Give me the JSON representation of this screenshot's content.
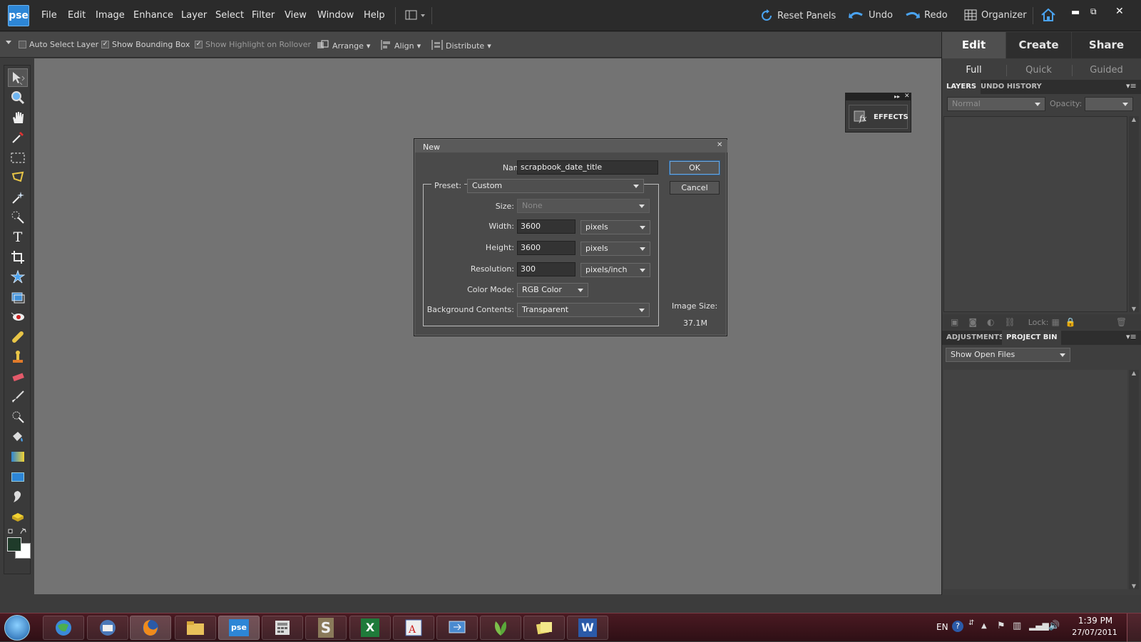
{
  "app": {
    "logo": "pse"
  },
  "menus": [
    "File",
    "Edit",
    "Image",
    "Enhance",
    "Layer",
    "Select",
    "Filter",
    "View",
    "Window",
    "Help"
  ],
  "toolbar_right": {
    "reset_panels": "Reset Panels",
    "undo": "Undo",
    "redo": "Redo",
    "organizer": "Organizer"
  },
  "options": {
    "auto_select_layer": "Auto Select Layer",
    "show_bounding_box": "Show Bounding Box",
    "show_highlight": "Show Highlight on Rollover",
    "arrange": "Arrange",
    "align": "Align",
    "distribute": "Distribute"
  },
  "right_panel": {
    "main_tabs": [
      "Edit",
      "Create",
      "Share"
    ],
    "sub_tabs": [
      "Full",
      "Quick",
      "Guided"
    ],
    "layers_tab": "LAYERS",
    "undo_history_tab": "UNDO HISTORY",
    "blend_mode": "Normal",
    "opacity_label": "Opacity:",
    "lock_label": "Lock:",
    "adjustments_tab": "ADJUSTMENTS",
    "project_bin_tab": "PROJECT BIN",
    "show_files": "Show Open Files"
  },
  "effects": {
    "label": "EFFECTS"
  },
  "dialog": {
    "title": "New",
    "name_label": "Name:",
    "name_value": "scrapbook_date_title",
    "preset_label": "Preset:",
    "preset_value": "Custom",
    "size_label": "Size:",
    "size_value": "None",
    "width_label": "Width:",
    "width_value": "3600",
    "width_unit": "pixels",
    "height_label": "Height:",
    "height_value": "3600",
    "height_unit": "pixels",
    "resolution_label": "Resolution:",
    "resolution_value": "300",
    "resolution_unit": "pixels/inch",
    "color_mode_label": "Color Mode:",
    "color_mode_value": "RGB Color",
    "background_label": "Background Contents:",
    "background_value": "Transparent",
    "ok": "OK",
    "cancel": "Cancel",
    "image_size_label": "Image Size:",
    "image_size_value": "37.1M"
  },
  "taskbar": {
    "language": "EN",
    "time": "1:39 PM",
    "date": "27/07/2011"
  },
  "colors": {
    "foreground": "#1f3b2a",
    "background": "#ffffff",
    "accent": "#2d86d6"
  }
}
